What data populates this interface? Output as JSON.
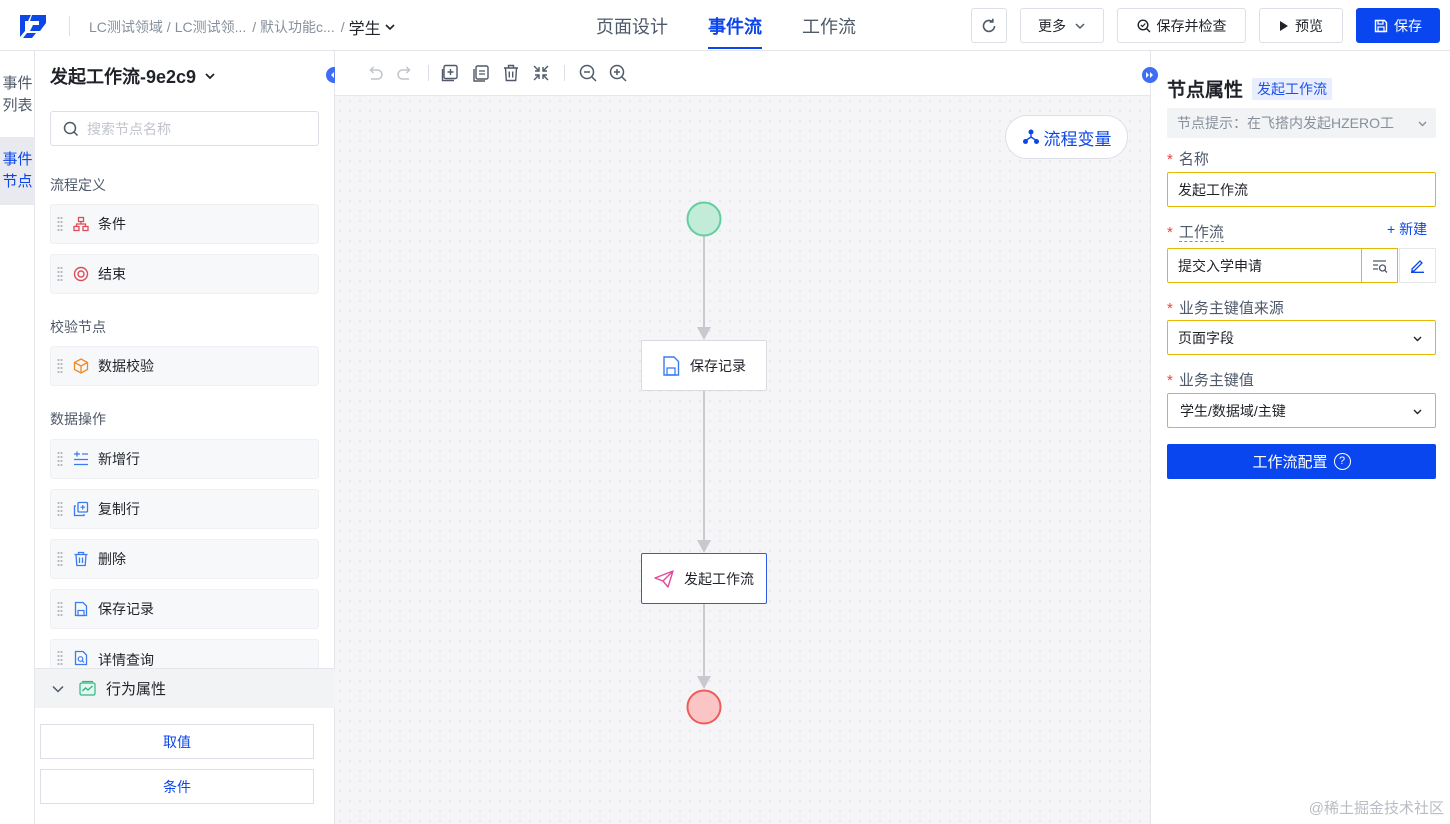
{
  "header": {
    "breadcrumb": [
      "LC测试领域 /",
      "LC测试领...",
      "/ 默认功能c...",
      "/"
    ],
    "current": "学生",
    "tabs": [
      "页面设计",
      "事件流",
      "工作流"
    ],
    "active_tab": "事件流",
    "buttons": {
      "more": "更多",
      "save_check": "保存并检查",
      "preview": "预览",
      "save": "保存"
    }
  },
  "side_tabs": [
    "事件列表",
    "事件节点"
  ],
  "left_panel": {
    "title": "发起工作流-9e2c9",
    "search_placeholder": "搜索节点名称",
    "sections": [
      {
        "label": "流程定义",
        "items": [
          {
            "label": "条件",
            "icon": "condition-icon"
          },
          {
            "label": "结束",
            "icon": "end-icon"
          }
        ]
      },
      {
        "label": "校验节点",
        "items": [
          {
            "label": "数据校验",
            "icon": "data-validate-icon"
          }
        ]
      },
      {
        "label": "数据操作",
        "items": [
          {
            "label": "新增行",
            "icon": "add-row-icon"
          },
          {
            "label": "复制行",
            "icon": "copy-row-icon"
          },
          {
            "label": "删除",
            "icon": "delete-icon"
          },
          {
            "label": "保存记录",
            "icon": "save-record-icon"
          },
          {
            "label": "详情查询",
            "icon": "detail-query-icon"
          }
        ]
      }
    ],
    "behavior": {
      "label": "行为属性",
      "buttons": [
        "取值",
        "条件"
      ]
    }
  },
  "canvas": {
    "variables_button": "流程变量",
    "nodes": [
      {
        "label": "保存记录"
      },
      {
        "label": "发起工作流"
      }
    ]
  },
  "right_panel": {
    "title": "节点属性",
    "tag": "发起工作流",
    "hint": "节点提示：在飞搭内发起HZERO工",
    "fields": {
      "name": {
        "label": "名称",
        "value": "发起工作流"
      },
      "workflow": {
        "label": "工作流",
        "value": "提交入学申请",
        "new_label": "+ 新建"
      },
      "key_source": {
        "label": "业务主键值来源",
        "value": "页面字段"
      },
      "key_value": {
        "label": "业务主键值",
        "value": "学生/数据域/主键"
      }
    },
    "config_button": "工作流配置"
  },
  "watermark": "@稀土掘金技术社区",
  "colors": {
    "primary": "#0a46ef",
    "start_node": "#c2ecd8",
    "end_node": "#fbc5c5",
    "required": "#f53f3f",
    "field_border": "#e6b800"
  }
}
